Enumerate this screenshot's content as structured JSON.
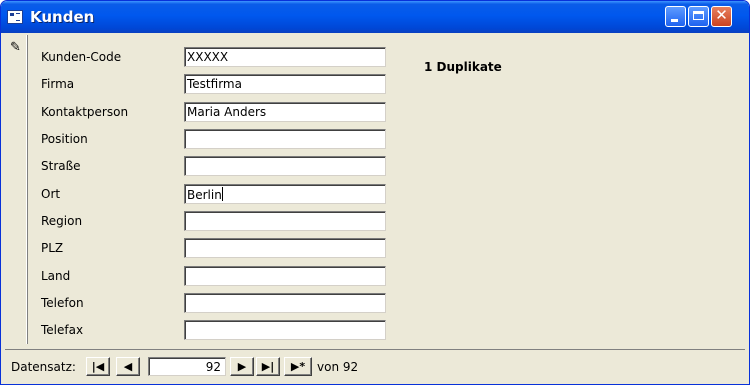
{
  "window": {
    "title": "Kunden"
  },
  "fields": [
    {
      "label": "Kunden-Code",
      "value": "XXXXX"
    },
    {
      "label": "Firma",
      "value": "Testfirma"
    },
    {
      "label": "Kontaktperson",
      "value": "Maria Anders"
    },
    {
      "label": "Position",
      "value": ""
    },
    {
      "label": "Straße",
      "value": ""
    },
    {
      "label": "Ort",
      "value": "Berlin"
    },
    {
      "label": "Region",
      "value": ""
    },
    {
      "label": "PLZ",
      "value": ""
    },
    {
      "label": "Land",
      "value": ""
    },
    {
      "label": "Telefon",
      "value": ""
    },
    {
      "label": "Telefax",
      "value": ""
    }
  ],
  "duplicate_info": "1 Duplikate",
  "navigation": {
    "label": "Datensatz:",
    "current_record": "92",
    "of_label": "von 92",
    "first_glyph": "|◀",
    "prev_glyph": "◀",
    "next_glyph": "▶",
    "last_glyph": "▶|",
    "new_glyph": "▶*"
  },
  "icons": [
    "form-icon",
    "minimize-icon",
    "maximize-icon",
    "close-icon",
    "pencil-icon"
  ],
  "colors": {
    "titlebar": "#0058ee",
    "window_bg": "#ece9d8",
    "close_button": "#c9431f"
  }
}
